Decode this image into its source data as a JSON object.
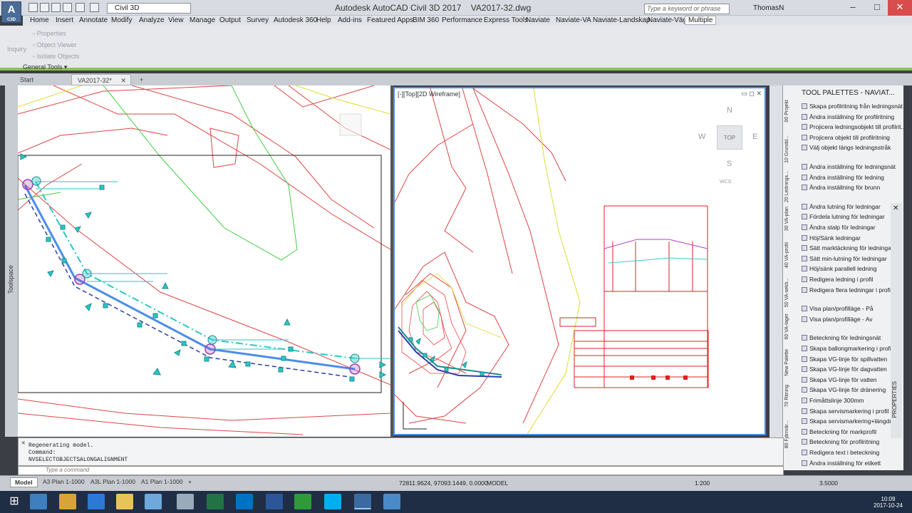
{
  "app": {
    "logo": "A",
    "logo_sub": "C3D",
    "title": "Autodesk AutoCAD Civil 3D 2017",
    "file": "VA2017-32.dwg",
    "workspace": "Civil 3D",
    "search_placeholder": "Type a keyword or phrase",
    "user": "ThomasN"
  },
  "menu": [
    "Home",
    "Insert",
    "Annotate",
    "Modify",
    "Analyze",
    "View",
    "Manage",
    "Output",
    "Survey",
    "Autodesk 360",
    "Help",
    "Add-ins",
    "Featured Apps",
    "BIM 360",
    "Performance",
    "Express Tools",
    "Naviate",
    "Naviate-VA",
    "Naviate-Landskap",
    "Naviate-Väg",
    "Multiple"
  ],
  "ribbon": {
    "inquiry": "Inquiry",
    "properties": "Properties",
    "object_viewer": "Object Viewer",
    "isolate": "Isolate Objects",
    "group": "General Tools"
  },
  "doc_tabs": [
    "Start",
    "VA2017-32*"
  ],
  "toolspace": "Toolspace",
  "viewport_label": "[-][Top][2D Wireframe]",
  "viewcube": {
    "n": "N",
    "s": "S",
    "e": "E",
    "w": "W",
    "top": "TOP",
    "wcs": "WCS"
  },
  "palette": {
    "title": "TOOL PALETTES - NAVIAT...",
    "tabs": [
      "00 Projekt",
      "10 Grundd...",
      "20 Lednings...",
      "30 VA-plan",
      "40 VA-profil",
      "50 VA-sekti...",
      "60 VA-lager",
      "New Palette",
      "70 Ritning",
      "80 Fjärrvär..."
    ],
    "items": [
      "Skapa profilritning från ledningsnät",
      "Ändra inställning för profilritning",
      "Projicera ledningsobjekt till profilrit...",
      "Projicera objekt till profilritning",
      "Välj objekt längs ledningsstråk",
      "Ändra inställning för ledningsnät",
      "Ändra inställning för ledning",
      "Ändra inställning för brunn",
      "Ändra lutning för ledningar",
      "Fördela lutning för ledningar",
      "Ändra stalp för ledningar",
      "Höj/Sänk ledningar",
      "Sätt marktäckning för ledningar",
      "Sätt min-lutning för ledningar",
      "Höj/sänk parallell ledning",
      "Redigera ledning i profil",
      "Redigera flera ledningar i profil",
      "Visa plan/profilläge - På",
      "Visa plan/profilläge - Av",
      "Beteckning för ledningsnät",
      "Skapa ballongmarkering i profil",
      "Skapa VG-linje för spillvatten",
      "Skapa VG-linje för dagvatten",
      "Skapa VG-linje för vatten",
      "Skapa VG-linje för dränering",
      "Frimåttslinje 300mm",
      "Skapa servismarkering i profil",
      "Skapa servismarkering+längdmått",
      "Beteckning för markprofil",
      "Beteckning för profilritning",
      "Redigera text i beteckning",
      "Ändra inställning för etikett"
    ],
    "properties": "PROPERTIES"
  },
  "command": {
    "lines": [
      "Regenerating model.",
      "Command:",
      "NVSELECTOBJECTSALONGALIGNMENT"
    ],
    "placeholder": "Type a command"
  },
  "layouts": [
    "Model",
    "A3 Plan 1-1000",
    "A3L Plan 1-1000",
    "A1 Plan 1-1000"
  ],
  "status": {
    "coords": "72811.9624, 97093.1449, 0.0000",
    "space": "MODEL",
    "scale": "1:200",
    "zoom": "3.5000"
  },
  "clock": {
    "time": "10:09",
    "date": "2017-10-24"
  }
}
